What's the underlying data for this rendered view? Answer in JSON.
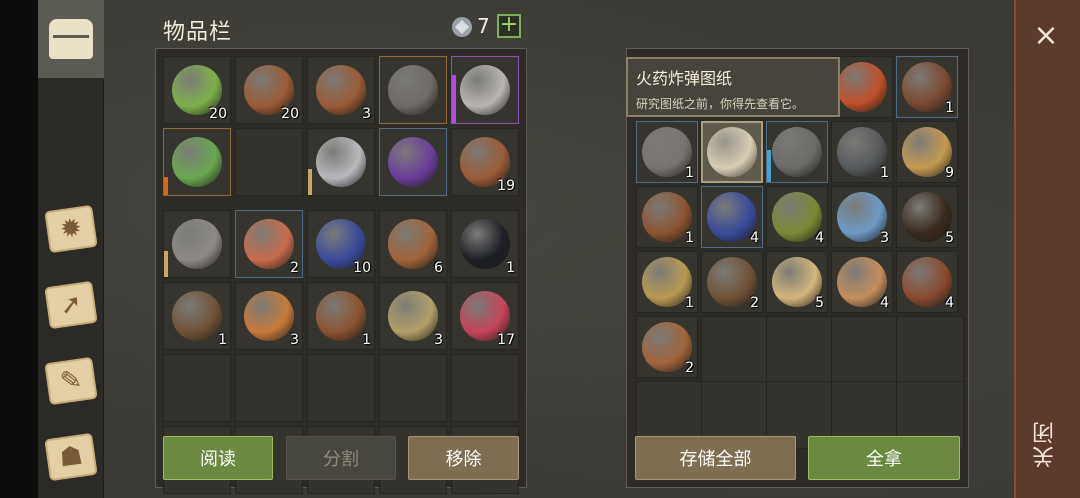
{
  "inventory": {
    "title": "物品栏",
    "currency_count": "7",
    "plus": "+",
    "slots_top": [
      {
        "count": "20",
        "icon": "green-food-icon",
        "color": "#7fb04a"
      },
      {
        "count": "20",
        "icon": "barrel-icon",
        "color": "#9a5a34"
      },
      {
        "count": "3",
        "icon": "barrel-icon",
        "color": "#9a5a34"
      },
      {
        "count": "",
        "icon": "horned-helmet-icon",
        "color": "#6e6a66"
      },
      {
        "count": "",
        "icon": "pickaxe-icon",
        "color": "#b8b5b0"
      },
      {
        "count": "",
        "icon": "green-dagger-icon",
        "color": "#69a84f"
      },
      {
        "count": "",
        "icon": "",
        "color": ""
      },
      {
        "count": "",
        "icon": "sword-icon",
        "color": "#b6b8bb"
      },
      {
        "count": "",
        "icon": "purple-book-icon",
        "color": "#6a3d9b"
      },
      {
        "count": "19",
        "icon": "leather-icon",
        "color": "#9b5a35"
      }
    ],
    "slots_bottom": [
      {
        "count": "",
        "icon": "halberd-icon",
        "color": "#8d8a86"
      },
      {
        "count": "2",
        "icon": "scroll-blueprint-icon",
        "color": "#c96b4a"
      },
      {
        "count": "10",
        "icon": "crystal-icon",
        "color": "#3a4a9a"
      },
      {
        "count": "6",
        "icon": "keg-icon",
        "color": "#a2643a"
      },
      {
        "count": "1",
        "icon": "coal-icon",
        "color": "#1d1f26"
      },
      {
        "count": "1",
        "icon": "bear-trap-icon",
        "color": "#6f5238"
      },
      {
        "count": "3",
        "icon": "hourglass-icon",
        "color": "#c77a3a"
      },
      {
        "count": "1",
        "icon": "bottle-icon",
        "color": "#8c5330"
      },
      {
        "count": "3",
        "icon": "sand-pile-icon",
        "color": "#b2a068"
      },
      {
        "count": "17",
        "icon": "berry-bowl-icon",
        "color": "#c4445a"
      }
    ],
    "buttons": {
      "read": "阅读",
      "split": "分割",
      "remove": "移除"
    }
  },
  "chest": {
    "tooltip": {
      "title": "火药炸弹图纸",
      "body": "研究图纸之前，你得先查看它。"
    },
    "slots": [
      {
        "count": "",
        "icon": "sun-book-icon",
        "color": "#c0502a"
      },
      {
        "count": "1",
        "icon": "collar-icon",
        "color": "#7b4a32"
      },
      {
        "count": "1",
        "icon": "pipe-icon",
        "color": "#7a7470"
      },
      {
        "count": "",
        "icon": "blueprint-icon",
        "color": "#d8cdb6"
      },
      {
        "count": "",
        "icon": "shield-icon",
        "color": "#6a6a66"
      },
      {
        "count": "1",
        "icon": "gears-icon",
        "color": "#56595b"
      },
      {
        "count": "9",
        "icon": "grain-sack-icon",
        "color": "#c49a52"
      },
      {
        "count": "1",
        "icon": "bottle-icon",
        "color": "#8c5330"
      },
      {
        "count": "4",
        "icon": "crystal-icon",
        "color": "#3a4a9a"
      },
      {
        "count": "4",
        "icon": "moss-ball-icon",
        "color": "#7a8a34"
      },
      {
        "count": "3",
        "icon": "potion-icon",
        "color": "#6b9ac4"
      },
      {
        "count": "5",
        "icon": "rope-icon",
        "color": "#3a2a1e"
      },
      {
        "count": "1",
        "icon": "goblet-icon",
        "color": "#b89a52"
      },
      {
        "count": "2",
        "icon": "bear-trap-icon",
        "color": "#6f5238"
      },
      {
        "count": "5",
        "icon": "candle-icon",
        "color": "#d2b67a"
      },
      {
        "count": "4",
        "icon": "cloth-icon",
        "color": "#c48e5c"
      },
      {
        "count": "4",
        "icon": "mug-icon",
        "color": "#8a4a2e"
      },
      {
        "count": "2",
        "icon": "keg-icon",
        "color": "#a2643a"
      }
    ],
    "buttons": {
      "store_all": "存储全部",
      "take_all": "全拿"
    }
  },
  "window": {
    "close_label": "关闭",
    "close_icon": "×"
  }
}
